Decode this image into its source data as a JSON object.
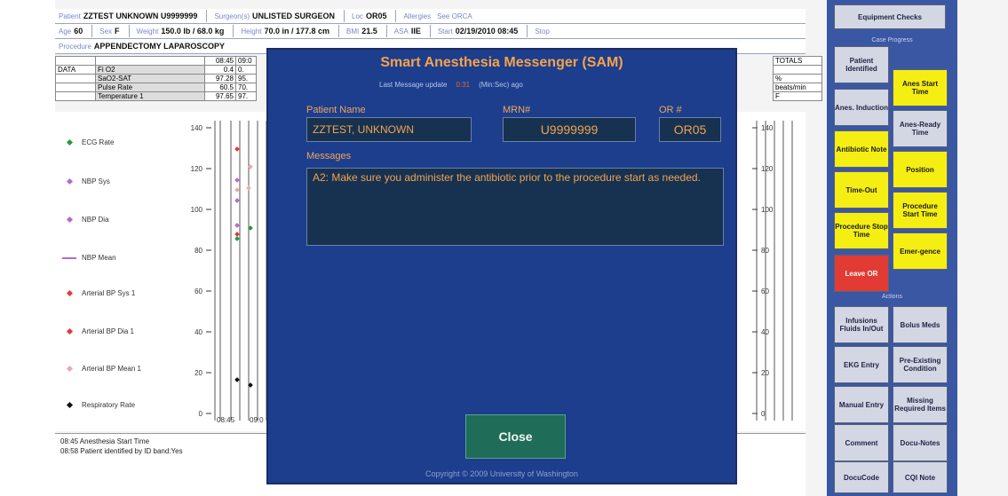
{
  "header": {
    "row1": [
      {
        "label": "Patient",
        "value": "ZZTEST UNKNOWN U9999999"
      },
      {
        "label": "Surgeon(s)",
        "value": "UNLISTED SURGEON"
      },
      {
        "label": "Loc",
        "value": "OR05"
      },
      {
        "label": "Allergies",
        "value": "See ORCA"
      }
    ],
    "row2": [
      {
        "label": "Age",
        "value": "60"
      },
      {
        "label": "Sex",
        "value": "F"
      },
      {
        "label": "Weight",
        "value": "150.0 lb / 68.0 kg"
      },
      {
        "label": "Height",
        "value": "70.0 in / 177.8 cm"
      },
      {
        "label": "BMI",
        "value": "21.5"
      },
      {
        "label": "ASA",
        "value": "IIE"
      },
      {
        "label": "Start",
        "value": "02/19/2010 08:45"
      },
      {
        "label": "Stop",
        "value": ""
      }
    ],
    "row3": [
      {
        "label": "Procedure",
        "value": "APPENDECTOMY LAPAROSCOPY"
      }
    ]
  },
  "data_table": {
    "times": [
      "08:45",
      "09:0"
    ],
    "rows": [
      {
        "group": "",
        "name": "",
        "v1": "08:45",
        "v2": "09:0"
      },
      {
        "group": "DATA",
        "name": "Fi O2",
        "v1": "0.4",
        "v2": "0."
      },
      {
        "group": "",
        "name": "SaO2-SAT",
        "v1": "97.28",
        "v2": "95."
      },
      {
        "group": "",
        "name": "Pulse Rate",
        "v1": "60.5",
        "v2": "70."
      },
      {
        "group": "",
        "name": "Temperature 1",
        "v1": "97.65",
        "v2": "97."
      }
    ],
    "totals_label": "TOTALS",
    "units": [
      "",
      "%",
      "beats/min",
      "F"
    ]
  },
  "legend": [
    {
      "label": "ECG Rate",
      "color": "#2a9a3a"
    },
    {
      "label": "NBP Sys",
      "color": "#b36bd0"
    },
    {
      "label": "NBP Dia",
      "color": "#b36bd0"
    },
    {
      "label": "NBP Mean",
      "color": "#b36bd0"
    },
    {
      "label": "Arterial BP Sys 1",
      "color": "#e2383e"
    },
    {
      "label": "Arterial BP Dia 1",
      "color": "#e2383e"
    },
    {
      "label": "Arterial BP Mean 1",
      "color": "#f0a6b0"
    },
    {
      "label": "Respiratory Rate",
      "color": "#111111"
    }
  ],
  "y_ticks": [
    "140",
    "120",
    "100",
    "80",
    "60",
    "40",
    "20",
    "0"
  ],
  "x_ticks": [
    "08:45",
    "09:0"
  ],
  "log": [
    "08:45 Anesthesia Start Time",
    "08:58 Patient identified by ID band:Yes"
  ],
  "modal": {
    "title": "Smart Anesthesia Messenger (SAM)",
    "last_update_label": "Last Message update",
    "last_update_value": "0:31",
    "last_update_suffix": "(Min:Sec) ago",
    "patient_name_label": "Patient Name",
    "patient_name": "ZZTEST, UNKNOWN",
    "mrn_label": "MRN#",
    "mrn": "U9999999",
    "or_label": "OR #",
    "or": "OR05",
    "messages_label": "Messages",
    "message": "A2: Make sure you administer the antibiotic prior to the procedure start as needed.",
    "close_label": "Close",
    "copyright": "Copyright © 2009 University of Washington"
  },
  "sidebar": {
    "top_button": "Equipment Checks",
    "section1": "Case Progress",
    "section2": "Actions",
    "buttons": [
      {
        "label": "Patient Identified",
        "style": "grey"
      },
      {
        "label": "Anes Start Time",
        "style": "yellow"
      },
      {
        "label": "Anes. Induction",
        "style": "grey"
      },
      {
        "label": "Anes-Ready Time",
        "style": "grey"
      },
      {
        "label": "Antibiotic Note",
        "style": "yellow"
      },
      {
        "label": "Position",
        "style": "yellow"
      },
      {
        "label": "Time-Out",
        "style": "yellow"
      },
      {
        "label": "Procedure Start Time",
        "style": "yellow"
      },
      {
        "label": "Procedure Stop Time",
        "style": "yellow"
      },
      {
        "label": "Emer-gence",
        "style": "yellow"
      },
      {
        "label": "Leave OR",
        "style": "red"
      },
      {
        "label": "Infusions Fluids In/Out",
        "style": "grey"
      },
      {
        "label": "Bolus Meds",
        "style": "grey"
      },
      {
        "label": "EKG Entry",
        "style": "grey"
      },
      {
        "label": "Pre-Existing Condition",
        "style": "grey"
      },
      {
        "label": "Manual Entry",
        "style": "grey"
      },
      {
        "label": "Missing Required Items",
        "style": "grey"
      },
      {
        "label": "Comment",
        "style": "grey"
      },
      {
        "label": "Docu-Notes",
        "style": "grey"
      },
      {
        "label": "DocuCode",
        "style": "grey"
      },
      {
        "label": "CQI Note",
        "style": "grey"
      }
    ]
  }
}
